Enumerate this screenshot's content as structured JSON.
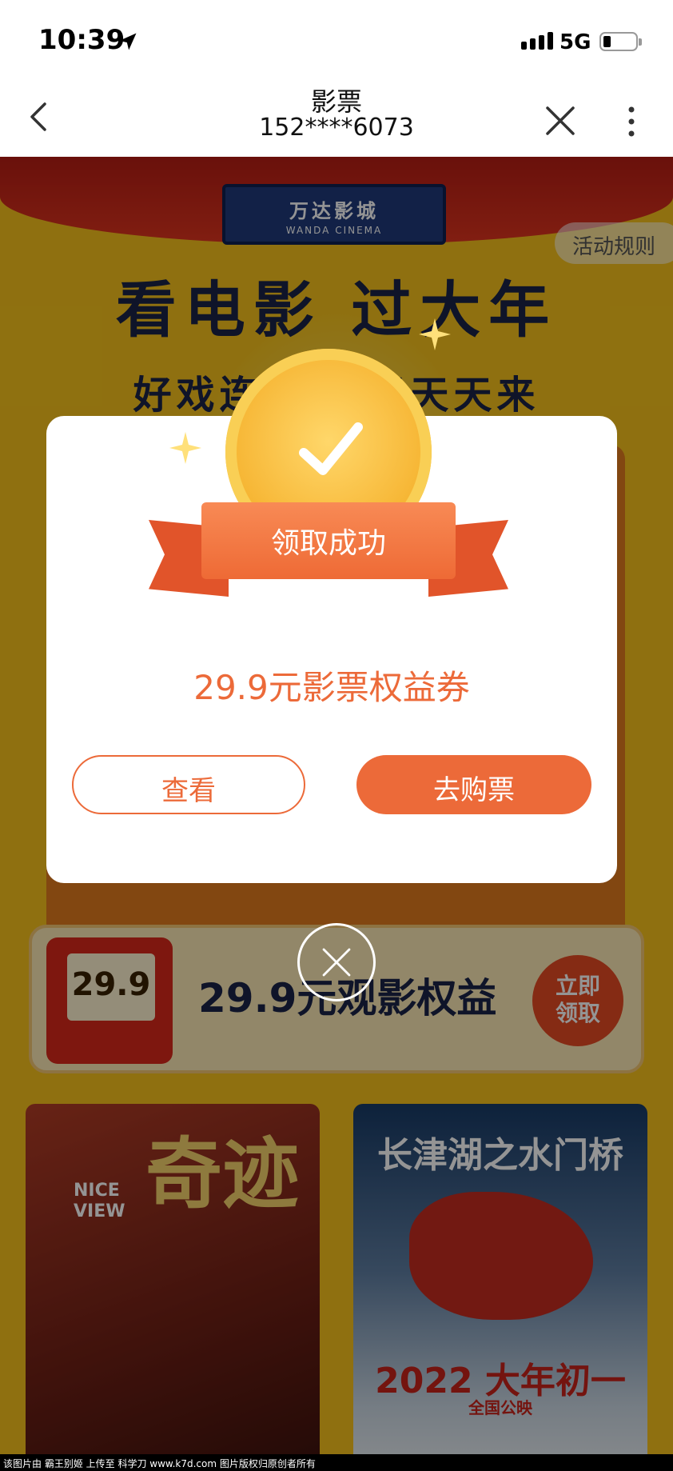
{
  "status_bar": {
    "time": "10:39",
    "network": "5G"
  },
  "nav": {
    "title": "影票",
    "subtitle": "152****6073"
  },
  "campaign": {
    "sign_name": "万达影城",
    "sign_en": "WANDA CINEMA",
    "rules_label": "活动规则",
    "headline": "看电影 过大年",
    "subline": "好戏连连 好运天天来",
    "benefit_thumb_value": "29.9",
    "benefit_text": "29.9元观影权益",
    "benefit_button": "立即领取",
    "poster_left_title": "奇迹",
    "poster_left_en": "NICE VIEW",
    "poster_right_title": "长津湖之水门桥",
    "poster_right_date": "2022 大年初一",
    "poster_right_release": "全国公映"
  },
  "dialog": {
    "badge_text": "领取成功",
    "coupon_text": "29.9元影票权益券",
    "view_button": "查看",
    "buy_button": "去购票"
  },
  "footer": {
    "text": "该图片由 霸王别姬 上传至 科学刀 www.k7d.com 图片版权归原创者所有"
  },
  "icons": {
    "back": "chevron-left-icon",
    "close": "close-icon",
    "more": "more-vertical-icon",
    "location": "location-arrow-icon",
    "check": "checkmark-icon",
    "dialog_close": "close-circle-icon"
  },
  "colors": {
    "accent": "#ec6a39",
    "campaign_bg": "#f6c21c",
    "headline": "#1a2448",
    "medal": "#f6b533"
  }
}
